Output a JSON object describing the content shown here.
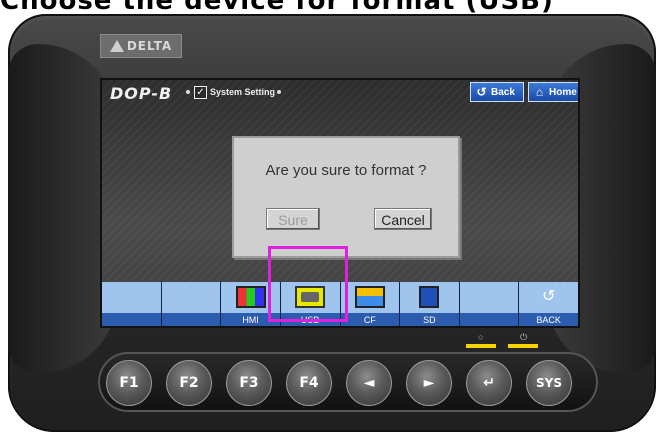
{
  "heading": "Choose the device for format (USB)",
  "device": {
    "logo": "DELTA"
  },
  "screen": {
    "brand": "DOP-B",
    "breadcrumb": "System Setting",
    "buttons": {
      "back": "Back",
      "home": "Home"
    },
    "dialog": {
      "message": "Are you sure to format ?",
      "sure": "Sure",
      "cancel": "Cancel"
    },
    "toolbar": {
      "items": [
        {
          "label": ""
        },
        {
          "label": ""
        },
        {
          "label": "HMI"
        },
        {
          "label": "USB"
        },
        {
          "label": "CF"
        },
        {
          "label": "SD"
        },
        {
          "label": ""
        },
        {
          "label": "BACK"
        }
      ]
    }
  },
  "keys": {
    "f1": "F1",
    "f2": "F2",
    "f3": "F3",
    "f4": "F4",
    "left": "◄",
    "right": "►",
    "enter": "↵",
    "sys": "SYS"
  },
  "colors": {
    "highlight": "#e020e0",
    "led": "#f6d400",
    "toolbar": "#9fc4ee"
  }
}
